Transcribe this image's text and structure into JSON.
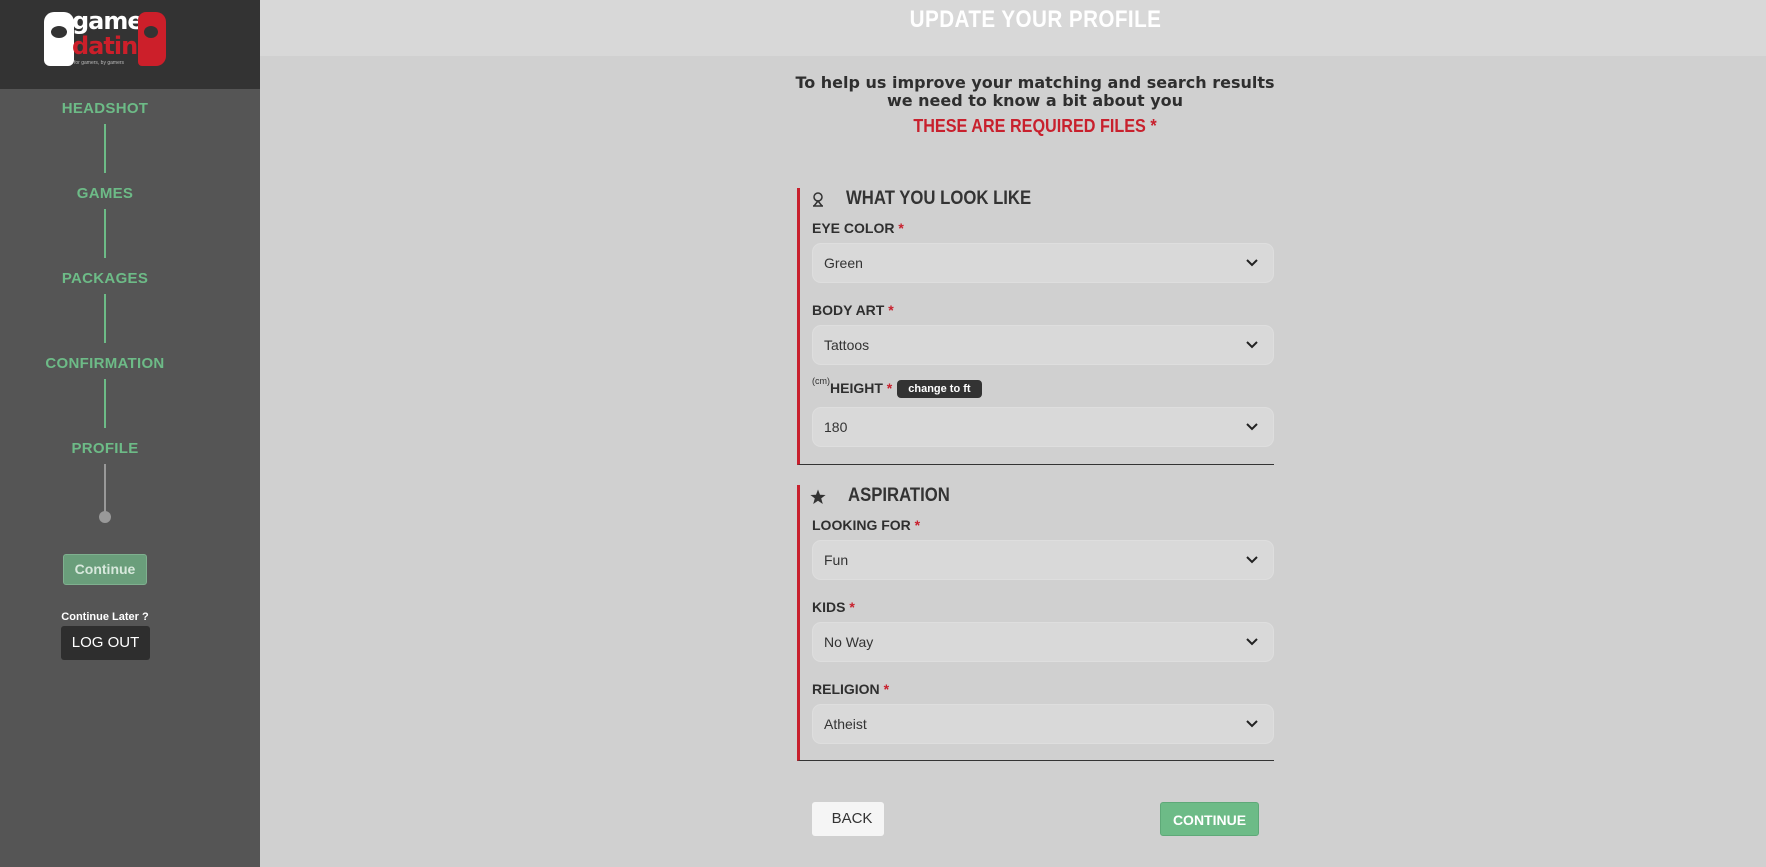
{
  "brand": {
    "logo_line1": "gamer",
    "logo_line2": "dating",
    "logo_tagline": "for gamers, by gamers"
  },
  "sidebar": {
    "steps": [
      {
        "label": "HEADSHOT"
      },
      {
        "label": "GAMES"
      },
      {
        "label": "PACKAGES"
      },
      {
        "label": "CONFIRMATION"
      },
      {
        "label": "PROFILE"
      }
    ],
    "continue_label": "Continue",
    "continue_later": "Continue Later ?",
    "logout_label": "LOG OUT"
  },
  "header": {
    "title": "UPDATE YOUR PROFILE"
  },
  "intro": {
    "text": "To help us improve your matching and search results we need to know a bit about you",
    "required_note": "THESE ARE REQUIRED FILES *"
  },
  "sections": [
    {
      "title": "WHAT YOU LOOK LIKE",
      "icon": "person-outline-icon",
      "fields": [
        {
          "label": "EYE COLOR",
          "required": "*",
          "value": "Green"
        },
        {
          "label": "BODY ART",
          "required": "*",
          "value": "Tattoos"
        },
        {
          "unit": "(cm)",
          "label": "HEIGHT",
          "required": "*",
          "badge": "change to ft",
          "value": "180"
        }
      ]
    },
    {
      "title": "ASPIRATION",
      "icon": "star-icon",
      "fields": [
        {
          "label": "LOOKING FOR",
          "required": "*",
          "value": "Fun"
        },
        {
          "label": "KIDS",
          "required": "*",
          "value": "No Way"
        },
        {
          "label": "RELIGION",
          "required": "*",
          "value": "Atheist"
        }
      ]
    }
  ],
  "footer": {
    "back_label": "BACK",
    "continue_label": "CONTINUE"
  },
  "colors": {
    "accent_green": "#6dbb87",
    "accent_red": "#c8202d",
    "sidebar_bg": "#555555",
    "main_bg": "#d0d0d0"
  }
}
